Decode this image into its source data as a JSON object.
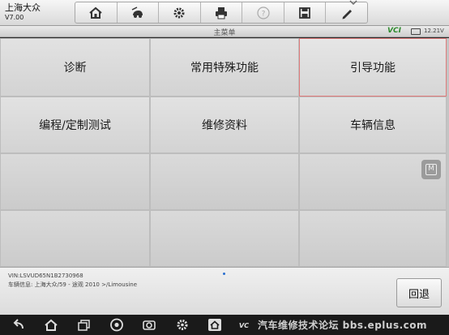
{
  "app": {
    "name": "上海大众",
    "version": "V7.00"
  },
  "toolbar": {
    "icons": [
      "home-icon",
      "car-icon",
      "gear-icon",
      "printer-icon",
      "help-icon",
      "save-icon",
      "pen-icon"
    ]
  },
  "titlebar": {
    "title": "主菜单",
    "vci": "VCI",
    "voltage": "12.21V"
  },
  "menu": {
    "items": [
      {
        "label": "诊断"
      },
      {
        "label": "常用特殊功能"
      },
      {
        "label": "引导功能"
      },
      {
        "label": "编程/定制测试"
      },
      {
        "label": "维修资料"
      },
      {
        "label": "车辆信息"
      }
    ]
  },
  "info": {
    "vin": "VIN:LSVUD65N1B2730968",
    "vehicle": "车辆信息: 上海大众/59 - 途观 2010 >/Limousine",
    "back_label": "回退"
  },
  "navbar": {
    "icons": [
      "back-icon",
      "home-icon",
      "recent-apps-icon",
      "chrome-icon",
      "camera-icon",
      "settings-icon",
      "app-home-icon",
      "vci-icon"
    ]
  },
  "watermark": "汽车维修技术论坛 bbs.eplus.com",
  "colors": {
    "active_border": "#e07b7b",
    "vci_green": "#2d8a2d"
  }
}
